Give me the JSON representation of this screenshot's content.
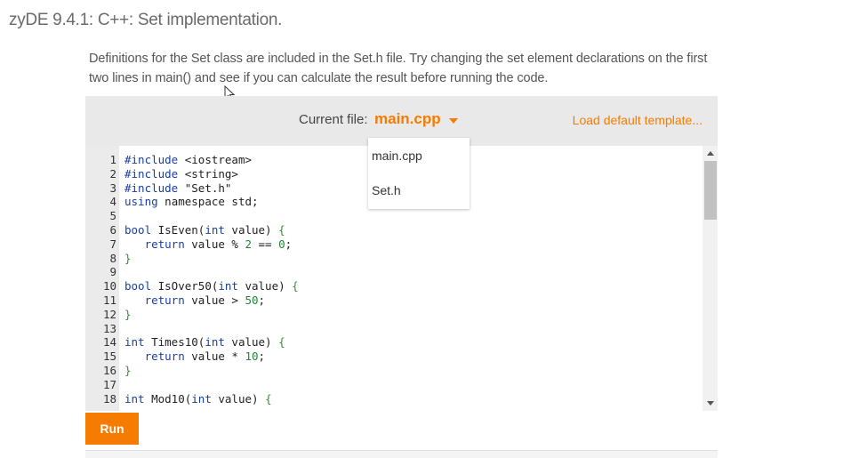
{
  "header": {
    "title": "zyDE 9.4.1: C++: Set implementation."
  },
  "instructions": {
    "line1": "Definitions for the Set class are included in the Set.h file. Try changing the set element declarations on the first",
    "line2": "two lines in main() and see if you can calculate the result before running the code."
  },
  "toolbar": {
    "current_file_label": "Current file:",
    "current_file": "main.cpp",
    "load_template": "Load default template..."
  },
  "file_menu": {
    "items": [
      "main.cpp",
      "Set.h"
    ]
  },
  "editor": {
    "lines": [
      {
        "n": "1",
        "tokens": [
          [
            "kw",
            "#include"
          ],
          [
            "plain",
            " <iostream>"
          ]
        ]
      },
      {
        "n": "2",
        "tokens": [
          [
            "kw",
            "#include"
          ],
          [
            "plain",
            " <string>"
          ]
        ]
      },
      {
        "n": "3",
        "tokens": [
          [
            "kw",
            "#include"
          ],
          [
            "plain",
            " \"Set.h\""
          ]
        ]
      },
      {
        "n": "4",
        "tokens": [
          [
            "kw",
            "using"
          ],
          [
            "plain",
            " namespace std;"
          ]
        ]
      },
      {
        "n": "5",
        "tokens": []
      },
      {
        "n": "6",
        "tokens": [
          [
            "kw",
            "bool"
          ],
          [
            "plain",
            " IsEven("
          ],
          [
            "kw",
            "int"
          ],
          [
            "plain",
            " value) "
          ],
          [
            "punc",
            "{"
          ]
        ]
      },
      {
        "n": "7",
        "tokens": [
          [
            "plain",
            "   "
          ],
          [
            "kw",
            "return"
          ],
          [
            "plain",
            " value % "
          ],
          [
            "num",
            "2"
          ],
          [
            "plain",
            " == "
          ],
          [
            "num",
            "0"
          ],
          [
            "plain",
            ";"
          ]
        ]
      },
      {
        "n": "8",
        "tokens": [
          [
            "punc",
            "}"
          ]
        ]
      },
      {
        "n": "9",
        "tokens": []
      },
      {
        "n": "10",
        "tokens": [
          [
            "kw",
            "bool"
          ],
          [
            "plain",
            " IsOver50("
          ],
          [
            "kw",
            "int"
          ],
          [
            "plain",
            " value) "
          ],
          [
            "punc",
            "{"
          ]
        ]
      },
      {
        "n": "11",
        "tokens": [
          [
            "plain",
            "   "
          ],
          [
            "kw",
            "return"
          ],
          [
            "plain",
            " value > "
          ],
          [
            "num",
            "50"
          ],
          [
            "plain",
            ";"
          ]
        ]
      },
      {
        "n": "12",
        "tokens": [
          [
            "punc",
            "}"
          ]
        ]
      },
      {
        "n": "13",
        "tokens": []
      },
      {
        "n": "14",
        "tokens": [
          [
            "kw",
            "int"
          ],
          [
            "plain",
            " Times10("
          ],
          [
            "kw",
            "int"
          ],
          [
            "plain",
            " value) "
          ],
          [
            "punc",
            "{"
          ]
        ]
      },
      {
        "n": "15",
        "tokens": [
          [
            "plain",
            "   "
          ],
          [
            "kw",
            "return"
          ],
          [
            "plain",
            " value * "
          ],
          [
            "num",
            "10"
          ],
          [
            "plain",
            ";"
          ]
        ]
      },
      {
        "n": "16",
        "tokens": [
          [
            "punc",
            "}"
          ]
        ]
      },
      {
        "n": "17",
        "tokens": []
      },
      {
        "n": "18",
        "tokens": [
          [
            "kw",
            "int"
          ],
          [
            "plain",
            " Mod10("
          ],
          [
            "kw",
            "int"
          ],
          [
            "plain",
            " value) "
          ],
          [
            "punc",
            "{"
          ]
        ]
      }
    ]
  },
  "actions": {
    "run_label": "Run"
  },
  "colors": {
    "accent": "#f57c00",
    "keyword": "#1a3fa0",
    "number": "#22863a"
  }
}
